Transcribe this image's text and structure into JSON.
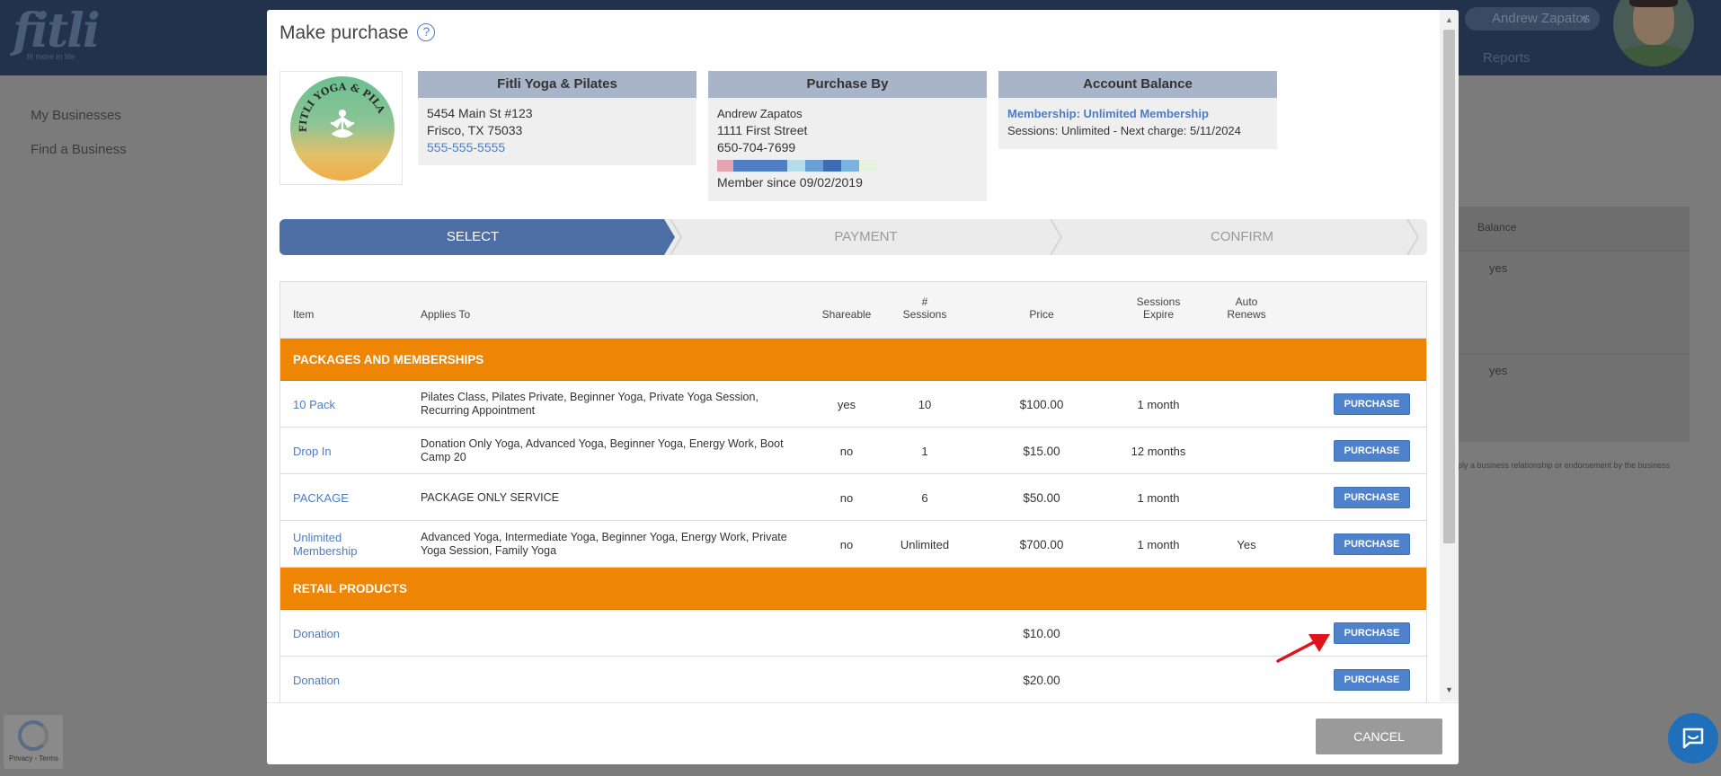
{
  "app": {
    "logo": "fitli",
    "tagline": "fit more in life"
  },
  "header": {
    "user_name": "Andrew Zapatos",
    "chevron": "∨",
    "nav_reports": "Reports"
  },
  "sidebar": {
    "items": [
      {
        "label": "My Businesses"
      },
      {
        "label": "Find a Business"
      }
    ]
  },
  "background_table": {
    "col_balance": "Balance",
    "rows": [
      "yes",
      "yes"
    ],
    "disclaimer": "ply a business relationship or endorsement by the business"
  },
  "recaptcha": {
    "text": "Privacy - Terms"
  },
  "modal": {
    "title": "Make purchase",
    "help_icon": "?",
    "business_logo_alt": "FITLI YOGA & PILATES",
    "business": {
      "name": "Fitli Yoga & Pilates",
      "address1": "5454 Main St #123",
      "address2": "Frisco, TX 75033",
      "phone": "555-555-5555"
    },
    "purchaser": {
      "heading": "Purchase By",
      "name": "Andrew Zapatos",
      "address": "1111 First Street",
      "phone": "650-704-7699",
      "member_since": "Member since 09/02/2019",
      "swatches": [
        "#e3a3b3",
        "#4f7ec4",
        "#4f7ec4",
        "#4f7ec4",
        "#b5dce8",
        "#6a9fd6",
        "#3d6cb5",
        "#7ab2e0",
        "#e8f0e0"
      ]
    },
    "account": {
      "heading": "Account Balance",
      "membership": "Membership: Unlimited Membership",
      "sessions": "Sessions: Unlimited -  Next charge: 5/11/2024"
    },
    "steps": [
      {
        "label": "SELECT",
        "active": true
      },
      {
        "label": "PAYMENT",
        "active": false
      },
      {
        "label": "CONFIRM",
        "active": false
      }
    ],
    "table": {
      "headers": {
        "item": "Item",
        "applies_to": "Applies To",
        "shareable": "Shareable",
        "sessions_1": "#",
        "sessions_2": "Sessions",
        "price": "Price",
        "expire_1": "Sessions",
        "expire_2": "Expire",
        "auto_1": "Auto",
        "auto_2": "Renews"
      },
      "sections": [
        {
          "title": "PACKAGES AND MEMBERSHIPS",
          "rows": [
            {
              "item": "10 Pack",
              "applies_to": "Pilates Class, Pilates Private, Beginner Yoga, Private Yoga Session, Recurring Appointment",
              "shareable": "yes",
              "sessions": "10",
              "price": "$100.00",
              "expire": "1 month",
              "auto": "",
              "button": "PURCHASE"
            },
            {
              "item": "Drop In",
              "applies_to": "Donation Only Yoga, Advanced Yoga, Beginner Yoga, Energy Work, Boot Camp 20",
              "shareable": "no",
              "sessions": "1",
              "price": "$15.00",
              "expire": "12 months",
              "auto": "",
              "button": "PURCHASE"
            },
            {
              "item": "PACKAGE",
              "applies_to": "PACKAGE ONLY SERVICE",
              "shareable": "no",
              "sessions": "6",
              "price": "$50.00",
              "expire": "1 month",
              "auto": "",
              "button": "PURCHASE"
            },
            {
              "item": "Unlimited Membership",
              "applies_to": "Advanced Yoga, Intermediate Yoga, Beginner Yoga, Energy Work, Private Yoga Session, Family Yoga",
              "shareable": "no",
              "sessions": "Unlimited",
              "price": "$700.00",
              "expire": "1 month",
              "auto": "Yes",
              "button": "PURCHASE"
            }
          ]
        },
        {
          "title": "RETAIL PRODUCTS",
          "rows": [
            {
              "item": "Donation",
              "applies_to": "",
              "shareable": "",
              "sessions": "",
              "price": "$10.00",
              "expire": "",
              "auto": "",
              "button": "PURCHASE"
            },
            {
              "item": "Donation",
              "applies_to": "",
              "shareable": "",
              "sessions": "",
              "price": "$20.00",
              "expire": "",
              "auto": "",
              "button": "PURCHASE"
            }
          ]
        }
      ]
    },
    "cancel_label": "CANCEL"
  },
  "colors": {
    "accent": "#4e6ea6",
    "section": "#ef8504",
    "link": "#4d7cc2",
    "button": "#4f82cc",
    "annotation_arrow": "#e0141c"
  }
}
